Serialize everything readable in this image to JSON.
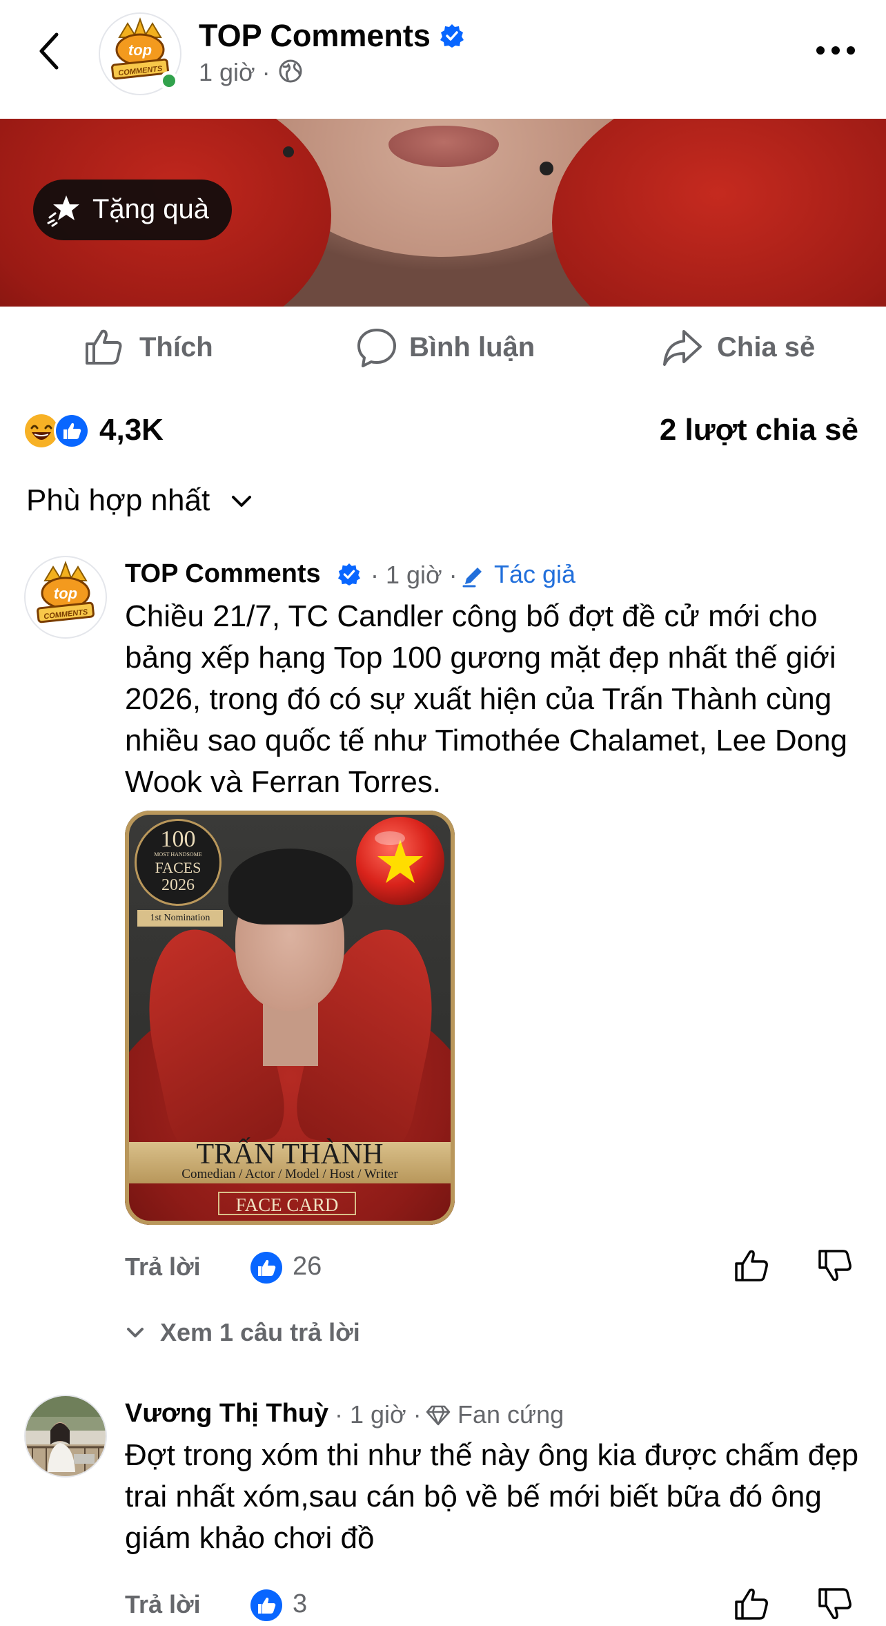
{
  "header": {
    "page_name": "TOP Comments",
    "post_time": "1 giờ ·"
  },
  "post": {
    "gift_label": "Tặng quà",
    "actions": {
      "like": "Thích",
      "comment": "Bình luận",
      "share": "Chia sẻ"
    },
    "reaction_count": "4,3K",
    "share_count": "2 lượt chia sẻ"
  },
  "sort_label": "Phù hợp nhất",
  "comments": [
    {
      "name": "TOP Comments",
      "meta": "· 1 giờ ·",
      "role": "Tác giả",
      "text": "Chiều 21/7, TC Candler công bố đợt đề cử mới cho bảng xếp hạng Top 100 gương mặt đẹp nhất thế giới 2026, trong đó có sự xuất hiện của Trấn Thành cùng nhiều sao quốc tế như Timothée Chalamet, Lee Dong Wook và Ferran Torres.",
      "image": {
        "badge_number": "100",
        "badge_sub": "MOST HANDSOME",
        "badge_faces": "FACES",
        "badge_year": "2026",
        "nomination": "1st Nomination",
        "name": "TRẤN THÀNH",
        "roles": "Comedian / Actor / Model / Host / Writer",
        "footer": "FACE CARD"
      },
      "reply_label": "Trả lời",
      "likes": "26",
      "view_replies": "Xem 1 câu trả lời"
    },
    {
      "name": "Vương Thị Thuỳ",
      "meta": "· 1 giờ ·",
      "badge": "Fan cứng",
      "text": "Đợt trong xóm thi như thế này ông kia được chấm đẹp trai nhất xóm,sau cán bộ về bế mới biết bữa đó ông giám khảo chơi đồ",
      "reply_label": "Trả lời",
      "likes": "3"
    }
  ],
  "colors": {
    "accent_blue": "#0866ff",
    "link_blue": "#216fdb",
    "secondary_text": "#65676b",
    "online_green": "#31a24c"
  }
}
